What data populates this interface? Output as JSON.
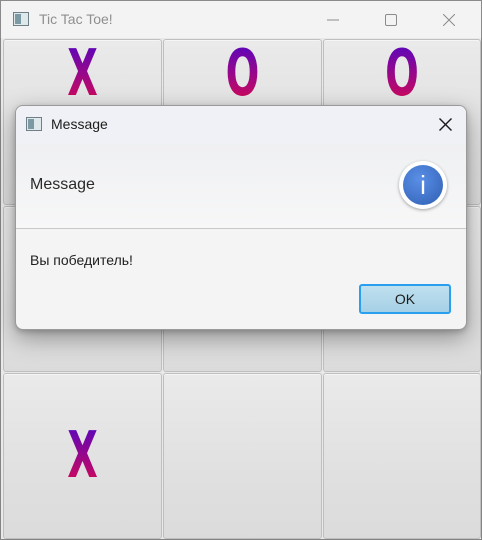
{
  "window": {
    "title": "Tic Tac Toe!"
  },
  "board": {
    "cells": [
      "X",
      "O",
      "O",
      "",
      "",
      "",
      "X",
      "",
      ""
    ]
  },
  "dialog": {
    "title": "Message",
    "header": "Message",
    "content": "Вы победитель!",
    "ok_label": "OK",
    "icon": "info-icon"
  },
  "colors": {
    "mark_gradient_top": "#5a07c8",
    "mark_gradient_bottom": "#e40a55",
    "ok_border": "#2a9ff0"
  }
}
